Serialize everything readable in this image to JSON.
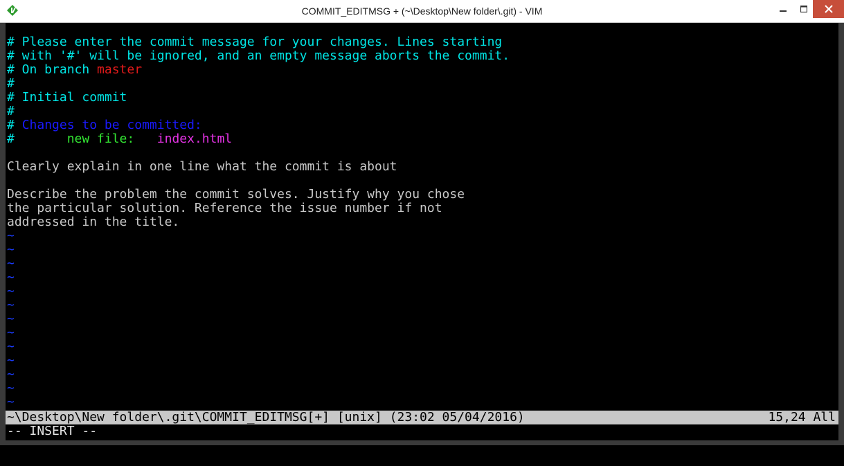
{
  "window": {
    "title": "COMMIT_EDITMSG + (~\\Desktop\\New folder\\.git) - VIM",
    "app_icon": "vim-icon",
    "accent": "#c74e3a"
  },
  "buffer": {
    "comment_line_1": "# Please enter the commit message for your changes. Lines starting",
    "comment_line_2": "# with '#' will be ignored, and an empty message aborts the commit.",
    "branch_prefix": "# On branch ",
    "branch_name": "master",
    "hash_only": "#",
    "initial_commit": "# Initial commit",
    "changes_header": "Changes to be committed:",
    "new_file_label": "new file:",
    "new_file_name": "index.html",
    "summary_line": "Clearly explain in one line what the commit is about",
    "body_line_1": "Describe the problem the commit solves. Justify why you chose",
    "body_line_2": "the particular solution. Reference the issue number if not",
    "body_line_3": "addressed in the title.",
    "tilde": "~"
  },
  "statusline": {
    "left": "~\\Desktop\\New folder\\.git\\COMMIT_EDITMSG[+] [unix] (23:02 05/04/2016)",
    "right": "15,24 All"
  },
  "mode": {
    "text": "-- INSERT --"
  },
  "colors": {
    "comment": "#00e5e5",
    "branch": "#e01a1a",
    "header": "#1a1aff",
    "new_file": "#33e633",
    "filename": "#e633e6",
    "tilde": "#1a3cff",
    "statusline_bg": "#c8c8c8"
  }
}
